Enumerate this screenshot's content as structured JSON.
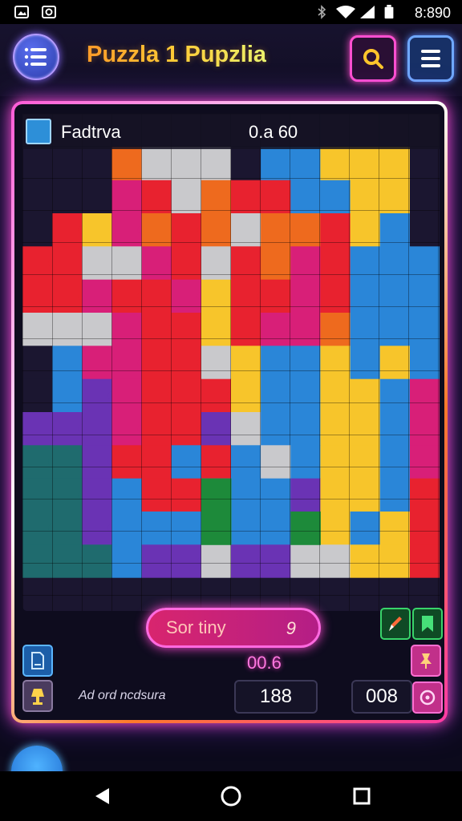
{
  "status_bar": {
    "time": "8:890",
    "icons": [
      "gallery-icon",
      "camera-icon",
      "bluetooth-icon",
      "wifi-icon",
      "signal-icon",
      "battery-icon"
    ]
  },
  "app_bar": {
    "title": "Puzzla 1 Pupzlia",
    "menu_icon": "list-icon",
    "search_icon": "search-icon",
    "options_icon": "hamburger-icon"
  },
  "board": {
    "header_title": "Fadtrva",
    "header_score": "0.a 60",
    "colors": {
      "red": "#e8222f",
      "yellow": "#f7c52b",
      "blue": "#2a86d8",
      "purple": "#6a33b4",
      "teal": "#1f6b6e",
      "gray": "#c9c9cc",
      "orange": "#ee6a1e",
      "magenta": "#d81f78",
      "green": "#1d8a3a",
      "dark": "#1b1630"
    }
  },
  "hint": {
    "text": "Sor tiny",
    "suffix": "9"
  },
  "progress_counter": "00.6",
  "bottom": {
    "label": "Ad ord ncdsura",
    "left_value": "188",
    "right_value": "008"
  },
  "tools": {
    "edit_icon": "pencil-icon",
    "bookmark_icon": "bookmark-icon",
    "doc_icon": "document-icon",
    "pin_icon": "pin-icon",
    "lamp_icon": "lamp-icon",
    "timer_icon": "timer-icon"
  },
  "nav": {
    "back_icon": "back-icon",
    "home_icon": "home-icon",
    "recents_icon": "recents-icon"
  }
}
